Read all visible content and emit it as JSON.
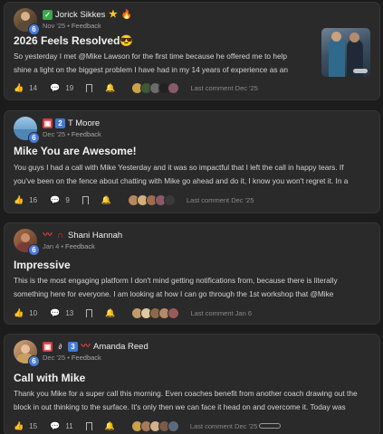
{
  "posts": [
    {
      "author": "Jorick Sikkes",
      "level": "6",
      "date": "Nov '25",
      "category": "Feedback",
      "title": "2026 Feels Resolved😎",
      "body_lines": [
        "So yesterday I met @Mike Lawson for the first time because he offered me to help",
        "shine a light on the biggest problem I have had in my 14 years of experience as an"
      ],
      "likes": "14",
      "comments": "19",
      "last_comment": "Last comment Dec '25"
    },
    {
      "author": "T Moore",
      "level": "6",
      "date": "Dec '25",
      "category": "Feedback",
      "title": "Mike You are Awesome!",
      "body_lines": [
        "You guys I had a call with Mike Yesterday and it was so impactful that I left the call in happy tears. If",
        "you've been on the fence about chatting with Mike go ahead and do it, I know you won't regret it. In a"
      ],
      "likes": "16",
      "comments": "9",
      "last_comment": "Last comment Dec '25"
    },
    {
      "author": "Shani Hannah",
      "level": "6",
      "date": "Jan 4",
      "category": "Feedback",
      "title": "Impressive",
      "body_lines": [
        "This is the most engaging platform I don't mind getting notifications from, because there is literally",
        "something here for everyone. I am looking at how I can go through the 1st workshop that @Mike"
      ],
      "likes": "10",
      "comments": "13",
      "last_comment": "Last comment Jan 6"
    },
    {
      "author": "Amanda Reed",
      "level": "6",
      "date": "Dec '25",
      "category": "Feedback",
      "title": "Call with Mike",
      "body_lines": [
        "Thank you Mike for a super call this morning. Even coaches benefit from another coach drawing out the",
        "block in out thinking to the surface. It's only then we can face it head on and overcome it. Today was"
      ],
      "likes": "15",
      "comments": "11",
      "last_comment": "Last comment Dec '25"
    }
  ],
  "badge_chars": {
    "check": "✓",
    "star": "★",
    "fire": "🔥",
    "two": "2",
    "three": "3"
  },
  "colors": {
    "background": "#1c1c1c",
    "card": "#2a2a2a",
    "level_badge": "#4a7bd8",
    "like_icon": "#e9b92c"
  },
  "icons": {
    "like": "thumbs-up-icon",
    "comment": "comment-icon",
    "bookmark": "bookmark-icon",
    "bell": "bell-icon"
  }
}
